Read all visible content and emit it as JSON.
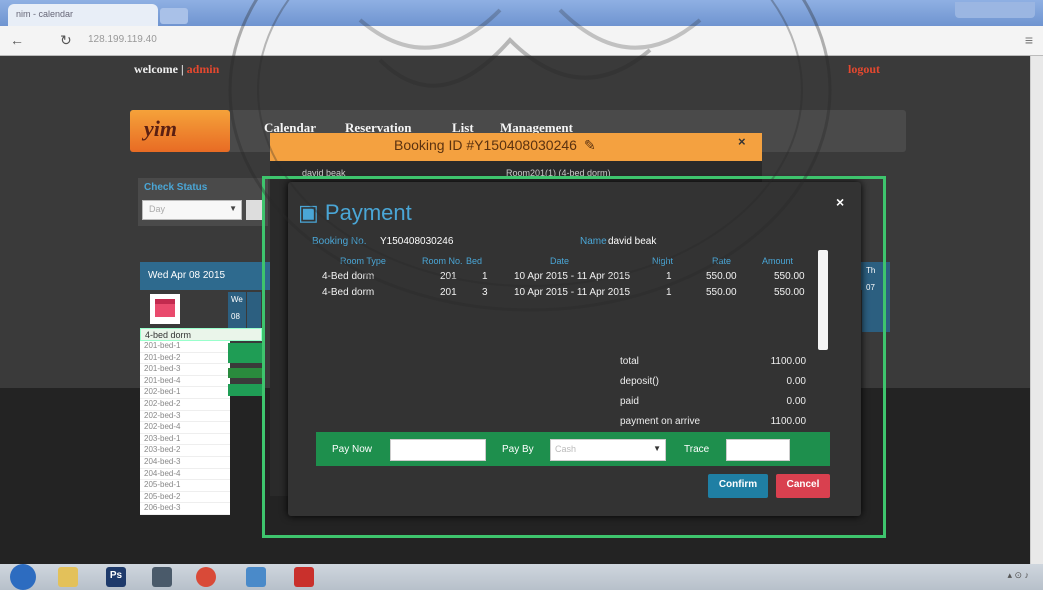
{
  "browser": {
    "tab_title": "nim - calendar",
    "url": "128.199.119.40"
  },
  "header": {
    "welcome": "welcome",
    "separator": "|",
    "user": "admin",
    "logout": "logout",
    "logo": "yim"
  },
  "nav": [
    "Calendar",
    "Reservation",
    "List",
    "Management"
  ],
  "check": {
    "title": "Check Status",
    "select": "Day"
  },
  "calendar": {
    "date": "Wed Apr 08 2015",
    "day_we": "We",
    "day_08": "08",
    "day_th": "Th",
    "day_07": "07",
    "room_type": "4-bed dorm",
    "rooms": [
      "201-bed-1",
      "201-bed-2",
      "201-bed-3",
      "201-bed-4",
      "202-bed-1",
      "202-bed-2",
      "202-bed-3",
      "202-bed-4",
      "203-bed-1",
      "203-bed-2",
      "204-bed-3",
      "204-bed-4",
      "205-bed-1",
      "205-bed-2",
      "206-bed-3"
    ]
  },
  "booking": {
    "title": "Booking ID #Y150408030246",
    "guest": "david beak",
    "room": "Room201(1) (4-bed dorm)"
  },
  "payment": {
    "title": "Payment",
    "booking_no_label": "Booking No.",
    "booking_no": "Y150408030246",
    "guest_label": "Name",
    "guest": "david beak",
    "columns": [
      "Room Type",
      "Room No.",
      "Bed",
      "Date",
      "Night",
      "Rate",
      "Amount"
    ],
    "rows": [
      {
        "type": "4-Bed dorm",
        "room": "201",
        "bed": "1",
        "date": "10 Apr 2015 - 11 Apr 2015",
        "night": "1",
        "rate": "550.00",
        "amount": "550.00"
      },
      {
        "type": "4-Bed dorm",
        "room": "201",
        "bed": "3",
        "date": "10 Apr 2015 - 11 Apr 2015",
        "night": "1",
        "rate": "550.00",
        "amount": "550.00"
      }
    ],
    "summary": [
      {
        "label": "total",
        "value": "1100.00"
      },
      {
        "label": "deposit()",
        "value": "0.00"
      },
      {
        "label": "paid",
        "value": "0.00"
      },
      {
        "label": "payment on arrive",
        "value": "1100.00"
      }
    ],
    "pay_now_label": "Pay Now",
    "pay_by_label": "Pay By",
    "pay_by_value": "Cash",
    "trace_label": "Trace",
    "confirm": "Confirm",
    "cancel": "Cancel"
  },
  "colors": {
    "accent": "#4aa6d6",
    "booking_bar": "#f4a140",
    "pay_bar": "#1e8f4d",
    "confirm": "#1f7fa4",
    "cancel": "#d9404f",
    "highlight_frame": "#3ec46d"
  },
  "icons": [
    "back-icon",
    "reload-icon",
    "menu-icon",
    "calendar-icon",
    "edit-icon",
    "close-icon",
    "payment-icon",
    "select-caret-icon"
  ]
}
